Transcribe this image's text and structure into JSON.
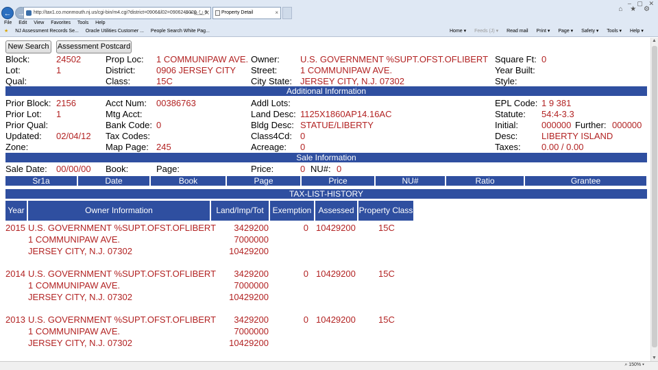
{
  "browser": {
    "url": "http://tax1.co.monmouth.nj.us/cgi-bin/m4.cgi?district=0906&l02=0906245020___0",
    "tab_title": "Property Detail",
    "tab_close": "×",
    "addr_tools": "⌕ ▾ ⊗ ↻ ✕",
    "window_controls": [
      "–",
      "▢",
      "✕"
    ],
    "window_icons": "⌂ ★ ⚙",
    "menu": [
      "File",
      "Edit",
      "View",
      "Favorites",
      "Tools",
      "Help"
    ],
    "favorites": [
      "NJ Assessment Records Se...",
      "Oracle Utilities Customer ...",
      "People Search White Pag..."
    ],
    "commands": [
      "Home ▾",
      "Feeds (J) ▾",
      "Read mail",
      "Print ▾",
      "Page ▾",
      "Safety ▾",
      "Tools ▾",
      "Help ▾"
    ],
    "zoom": "150%"
  },
  "buttons": {
    "new_search": "New Search",
    "postcard": "Assessment Postcard"
  },
  "property": {
    "block_label": "Block:",
    "block": "24502",
    "lot_label": "Lot:",
    "lot": "1",
    "qual_label": "Qual:",
    "qual": "",
    "prop_loc_label": "Prop Loc:",
    "prop_loc": "1 COMMUNIPAW AVE.",
    "district_label": "District:",
    "district": "0906 JERSEY CITY",
    "class_label": "Class:",
    "class": "15C",
    "owner_label": "Owner:",
    "owner": "U.S. GOVERNMENT %SUPT.OFST.OFLIBERT",
    "street_label": "Street:",
    "street": "1 COMMUNIPAW AVE.",
    "city_state_label": "City State:",
    "city_state": "JERSEY CITY, N.J. 07302",
    "sqft_label": "Square Ft:",
    "sqft": "0",
    "year_built_label": "Year Built:",
    "year_built": "",
    "style_label": "Style:",
    "style": ""
  },
  "additional": {
    "header": "Additional Information",
    "prior_block_label": "Prior Block:",
    "prior_block": "2156",
    "prior_lot_label": "Prior Lot:",
    "prior_lot": "1",
    "prior_qual_label": "Prior Qual:",
    "prior_qual": "",
    "updated_label": "Updated:",
    "updated": "02/04/12",
    "zone_label": "Zone:",
    "zone": "",
    "acct_num_label": "Acct Num:",
    "acct_num": "00386763",
    "mtg_acct_label": "Mtg Acct:",
    "mtg_acct": "",
    "bank_code_label": "Bank Code:",
    "bank_code": "0",
    "tax_codes_label": "Tax Codes:",
    "tax_codes": "",
    "map_page_label": "Map Page:",
    "map_page": "245",
    "addl_lots_label": "Addl Lots:",
    "addl_lots": "",
    "land_desc_label": "Land Desc:",
    "land_desc": "1125X1860AP14.16AC",
    "bldg_desc_label": "Bldg Desc:",
    "bldg_desc": "STATUE/LIBERTY",
    "class4cd_label": "Class4Cd:",
    "class4cd": "0",
    "acreage_label": "Acreage:",
    "acreage": "0",
    "epl_code_label": "EPL Code:",
    "epl_code": "1 9 381",
    "statute_label": "Statute:",
    "statute": "54:4-3.3",
    "initial_label": "Initial:",
    "initial": "000000",
    "further_label": "Further:",
    "further": "000000",
    "desc_label": "Desc:",
    "desc": "LIBERTY ISLAND",
    "taxes_label": "Taxes:",
    "taxes": "0.00 / 0.00"
  },
  "sale": {
    "header": "Sale Information",
    "sale_date_label": "Sale Date:",
    "sale_date": "00/00/00",
    "book_label": "Book:",
    "book": "",
    "page_label": "Page:",
    "page": "",
    "price_label": "Price:",
    "price": "0",
    "nu_label": "NU#:",
    "nu": "0",
    "columns": [
      "Sr1a",
      "Date",
      "Book",
      "Page",
      "Price",
      "NU#",
      "Ratio",
      "Grantee"
    ]
  },
  "tax_history": {
    "header": "TAX-LIST-HISTORY",
    "columns": [
      "Year",
      "Owner Information",
      "Land/Imp/Tot",
      "Exemption",
      "Assessed",
      "Property Class"
    ],
    "rows": [
      {
        "year": "2015",
        "owner": "U.S. GOVERNMENT %SUPT.OFST.OFLIBERT",
        "street": "1 COMMUNIPAW AVE.",
        "city": "JERSEY CITY, N.J. 07302",
        "land": "3429200",
        "imp": "7000000",
        "tot": "10429200",
        "exemption": "0",
        "assessed": "10429200",
        "class": "15C"
      },
      {
        "year": "2014",
        "owner": "U.S. GOVERNMENT %SUPT.OFST.OFLIBERT",
        "street": "1 COMMUNIPAW AVE.",
        "city": "JERSEY CITY, N.J. 07302",
        "land": "3429200",
        "imp": "7000000",
        "tot": "10429200",
        "exemption": "0",
        "assessed": "10429200",
        "class": "15C"
      },
      {
        "year": "2013",
        "owner": "U.S. GOVERNMENT %SUPT.OFST.OFLIBERT",
        "street": "1 COMMUNIPAW AVE.",
        "city": "JERSEY CITY, N.J. 07302",
        "land": "3429200",
        "imp": "7000000",
        "tot": "10429200",
        "exemption": "0",
        "assessed": "10429200",
        "class": "15C"
      }
    ]
  }
}
